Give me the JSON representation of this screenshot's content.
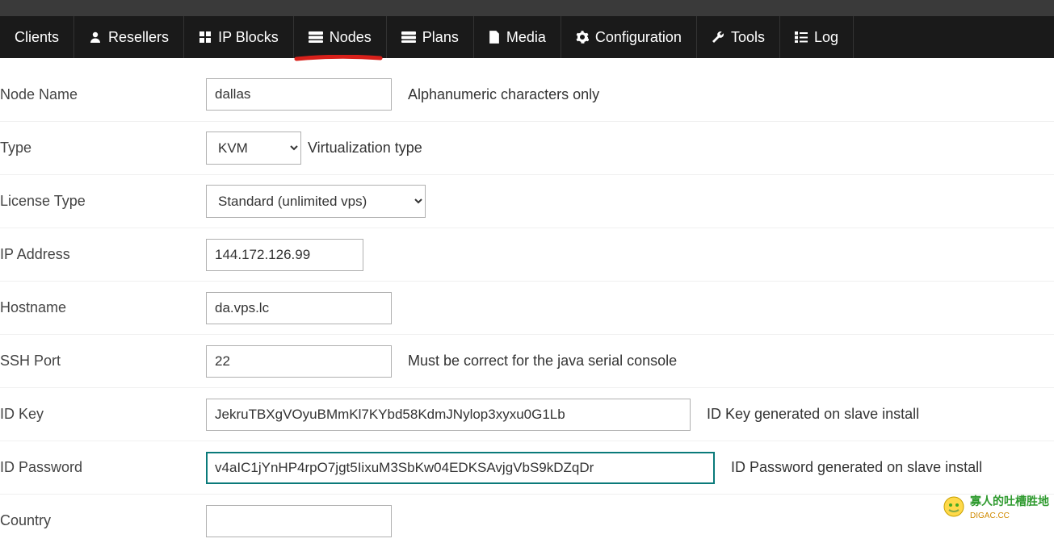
{
  "nav": {
    "clients": "Clients",
    "resellers": "Resellers",
    "ipblocks": "IP Blocks",
    "nodes": "Nodes",
    "plans": "Plans",
    "media": "Media",
    "configuration": "Configuration",
    "tools": "Tools",
    "log": "Log"
  },
  "form": {
    "node_name": {
      "label": "Node Name",
      "value": "dallas",
      "hint": "Alphanumeric characters only"
    },
    "type": {
      "label": "Type",
      "value": "KVM",
      "hint": "Virtualization type"
    },
    "license_type": {
      "label": "License Type",
      "value": "Standard (unlimited vps)"
    },
    "ip_address": {
      "label": "IP Address",
      "value": "144.172.126.99"
    },
    "hostname": {
      "label": "Hostname",
      "value": "da.vps.lc"
    },
    "ssh_port": {
      "label": "SSH Port",
      "value": "22",
      "hint": "Must be correct for the java serial console"
    },
    "id_key": {
      "label": "ID Key",
      "value": "JekruTBXgVOyuBMmKl7KYbd58KdmJNylop3xyxu0G1Lb",
      "hint": "ID Key generated on slave install"
    },
    "id_password": {
      "label": "ID Password",
      "value": "v4aIC1jYnHP4rpO7jgt5IixuM3SbKw04EDKSAvjgVbS9kDZqDr",
      "hint": "ID Password generated on slave install"
    },
    "country": {
      "label": "Country",
      "value": ""
    }
  },
  "watermark": {
    "line1": "寡人的吐槽胜地",
    "line2": "DIGAC.CC"
  }
}
